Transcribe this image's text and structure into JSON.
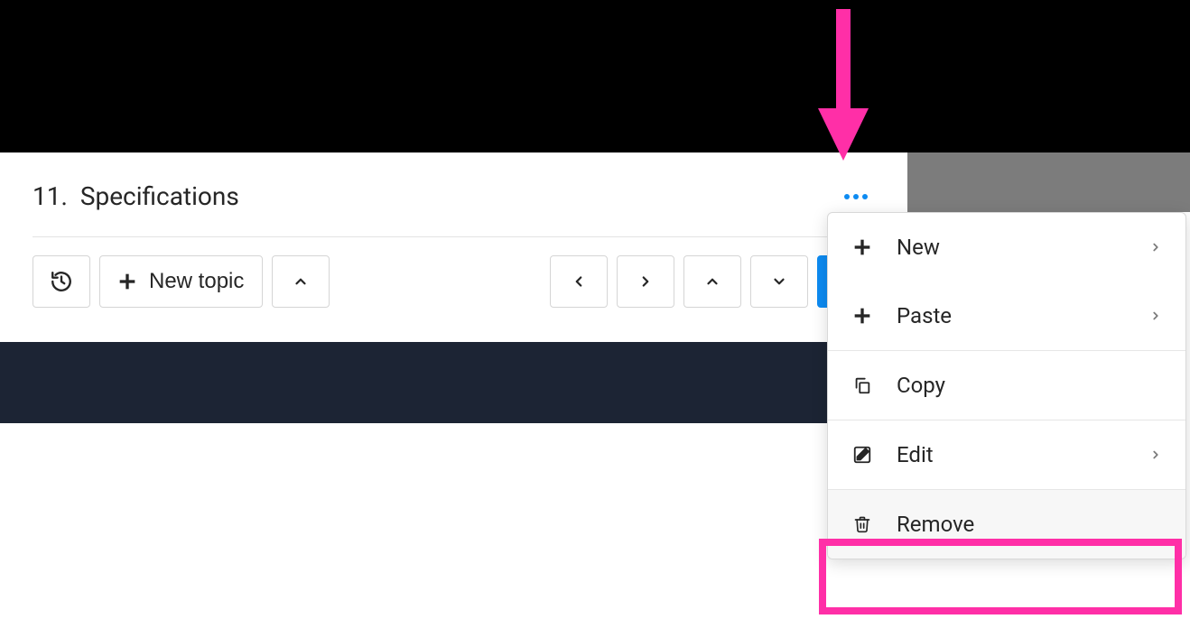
{
  "annotation_color": "#ff2fa7",
  "row": {
    "number": "11.",
    "title": "Specifications"
  },
  "toolbar": {
    "new_topic_label": "New topic"
  },
  "menu": {
    "new_label": "New",
    "paste_label": "Paste",
    "copy_label": "Copy",
    "edit_label": "Edit",
    "remove_label": "Remove"
  }
}
